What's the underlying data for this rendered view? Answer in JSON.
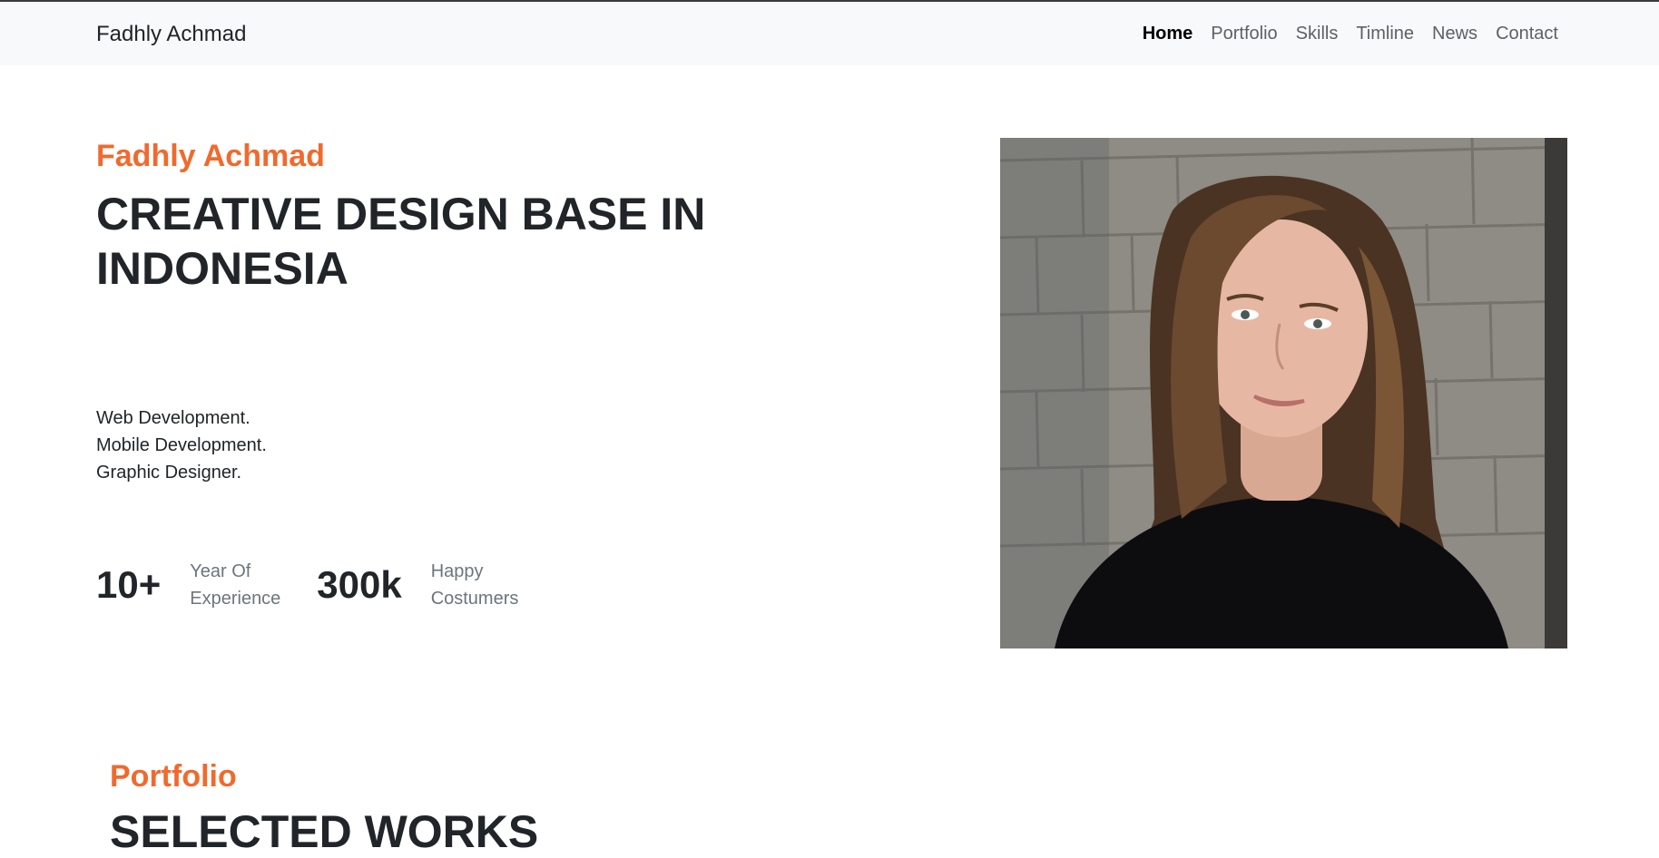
{
  "nav": {
    "brand": "Fadhly Achmad",
    "links": [
      "Home",
      "Portfolio",
      "Skills",
      "Timline",
      "News",
      "Contact"
    ]
  },
  "hero": {
    "name": "Fadhly Achmad",
    "title": "CREATIVE DESIGN BASE IN INDONESIA",
    "services": [
      "Web Development.",
      "Mobile Development.",
      "Graphic Designer."
    ],
    "stats": [
      {
        "value": "10+",
        "label_line1": "Year Of",
        "label_line2": "Experience"
      },
      {
        "value": "300k",
        "label_line1": "Happy",
        "label_line2": "Costumers"
      }
    ]
  },
  "portfolio": {
    "label": "Portfolio",
    "title": "SELECTED WORKS"
  },
  "colors": {
    "accent": "#f06a2e",
    "text": "#212529",
    "muted": "#6c757d",
    "navbar_bg": "#f8f9fa"
  }
}
